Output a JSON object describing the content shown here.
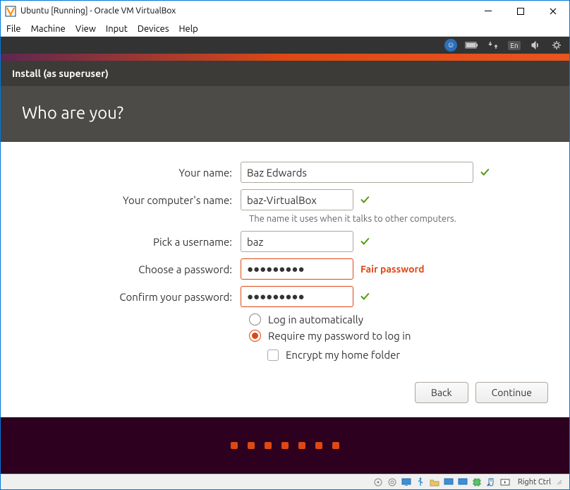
{
  "window": {
    "title": "Ubuntu [Running] - Oracle VM VirtualBox"
  },
  "vb_menu": [
    "File",
    "Machine",
    "View",
    "Input",
    "Devices",
    "Help"
  ],
  "ubuntu_topbar": {
    "lang": "En"
  },
  "installer": {
    "header": "Install (as superuser)",
    "title": "Who are you?",
    "labels": {
      "name": "Your name:",
      "computer": "Your computer's name:",
      "computer_hint": "The name it uses when it talks to other computers.",
      "username": "Pick a username:",
      "password": "Choose a password:",
      "confirm": "Confirm your password:"
    },
    "values": {
      "name": "Baz Edwards",
      "computer": "baz-VirtualBox",
      "username": "baz",
      "password": "●●●●●●●●●",
      "confirm": "●●●●●●●●●",
      "strength": "Fair password"
    },
    "options": {
      "auto_login": "Log in automatically",
      "require_pw": "Require my password to log in",
      "encrypt": "Encrypt my home folder"
    },
    "buttons": {
      "back": "Back",
      "continue": "Continue"
    }
  },
  "vb_status": {
    "host_key": "Right Ctrl"
  }
}
